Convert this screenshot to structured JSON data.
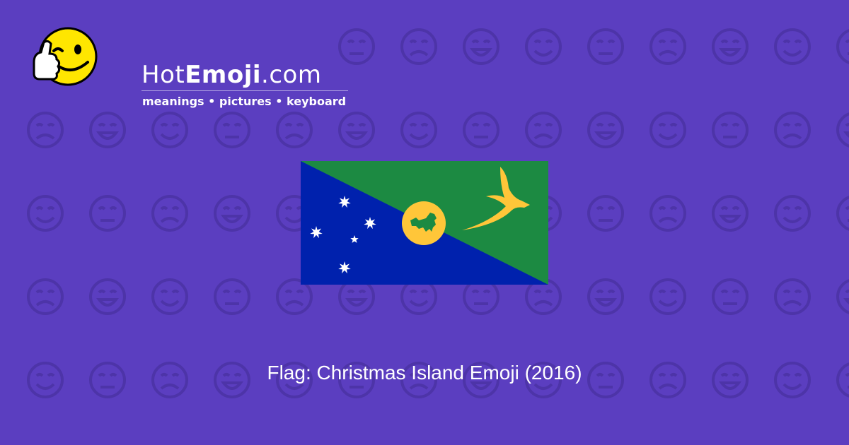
{
  "site": {
    "name_light_1": "Hot",
    "name_bold": "Emoji",
    "name_light_2": ".com",
    "tagline": "meanings • pictures • keyboard"
  },
  "emoji": {
    "caption": "Flag: Christmas Island Emoji (2016)",
    "flag_colors": {
      "blue": "#0021ad",
      "green": "#1c8a42",
      "gold": "#ffc639"
    }
  },
  "colors": {
    "background": "#5b3ec0",
    "pattern": "#4f36ac"
  }
}
